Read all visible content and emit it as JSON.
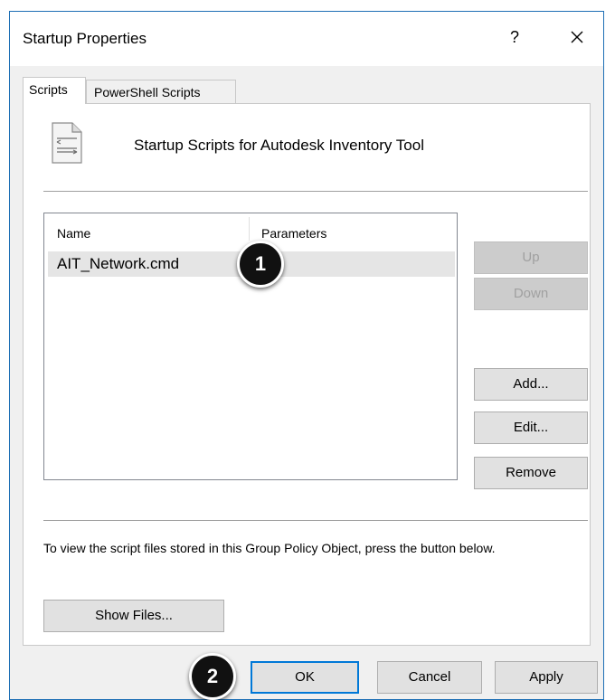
{
  "window": {
    "title": "Startup Properties",
    "help_label": "?",
    "close_icon": "close-icon"
  },
  "tabs": [
    {
      "label": "Scripts",
      "selected": true
    },
    {
      "label": "PowerShell Scripts",
      "selected": false
    }
  ],
  "panel": {
    "icon": "script-file-icon",
    "heading": "Startup Scripts for Autodesk Inventory Tool"
  },
  "scripts_table": {
    "columns": [
      "Name",
      "Parameters"
    ],
    "rows": [
      {
        "name": "AIT_Network.cmd",
        "parameters": ""
      }
    ]
  },
  "side_buttons": {
    "up": "Up",
    "down": "Down",
    "add": "Add...",
    "edit": "Edit...",
    "remove": "Remove"
  },
  "info_text": "To view the script files stored in this Group Policy Object, press the button below.",
  "show_files_label": "Show Files...",
  "footer_buttons": {
    "ok": "OK",
    "cancel": "Cancel",
    "apply": "Apply"
  },
  "callouts": [
    "1",
    "2"
  ],
  "colors": {
    "accent": "#0078d7",
    "callout": "#111111",
    "dialog_bg": "#f0f0f0"
  }
}
